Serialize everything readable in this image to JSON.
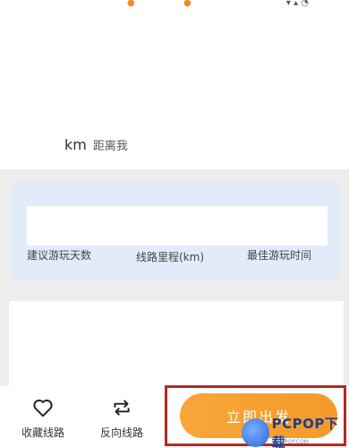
{
  "route": {
    "distance_unit": "km",
    "distance_text": "距离我"
  },
  "stats": {
    "days_label": "建议游玩天数",
    "mileage_label": "线路里程(km)",
    "best_time_label": "最佳游玩时间"
  },
  "bottom_bar": {
    "favorite_label": "收藏线路",
    "reverse_label": "反向线路",
    "start_label": "立即出发"
  },
  "watermark": {
    "brand": "PCPOP下载",
    "sub": "PCPOP.COM"
  },
  "colors": {
    "accent": "#f5a033",
    "stats_panel": "#e1ebfa",
    "highlight": "#b32a24"
  }
}
